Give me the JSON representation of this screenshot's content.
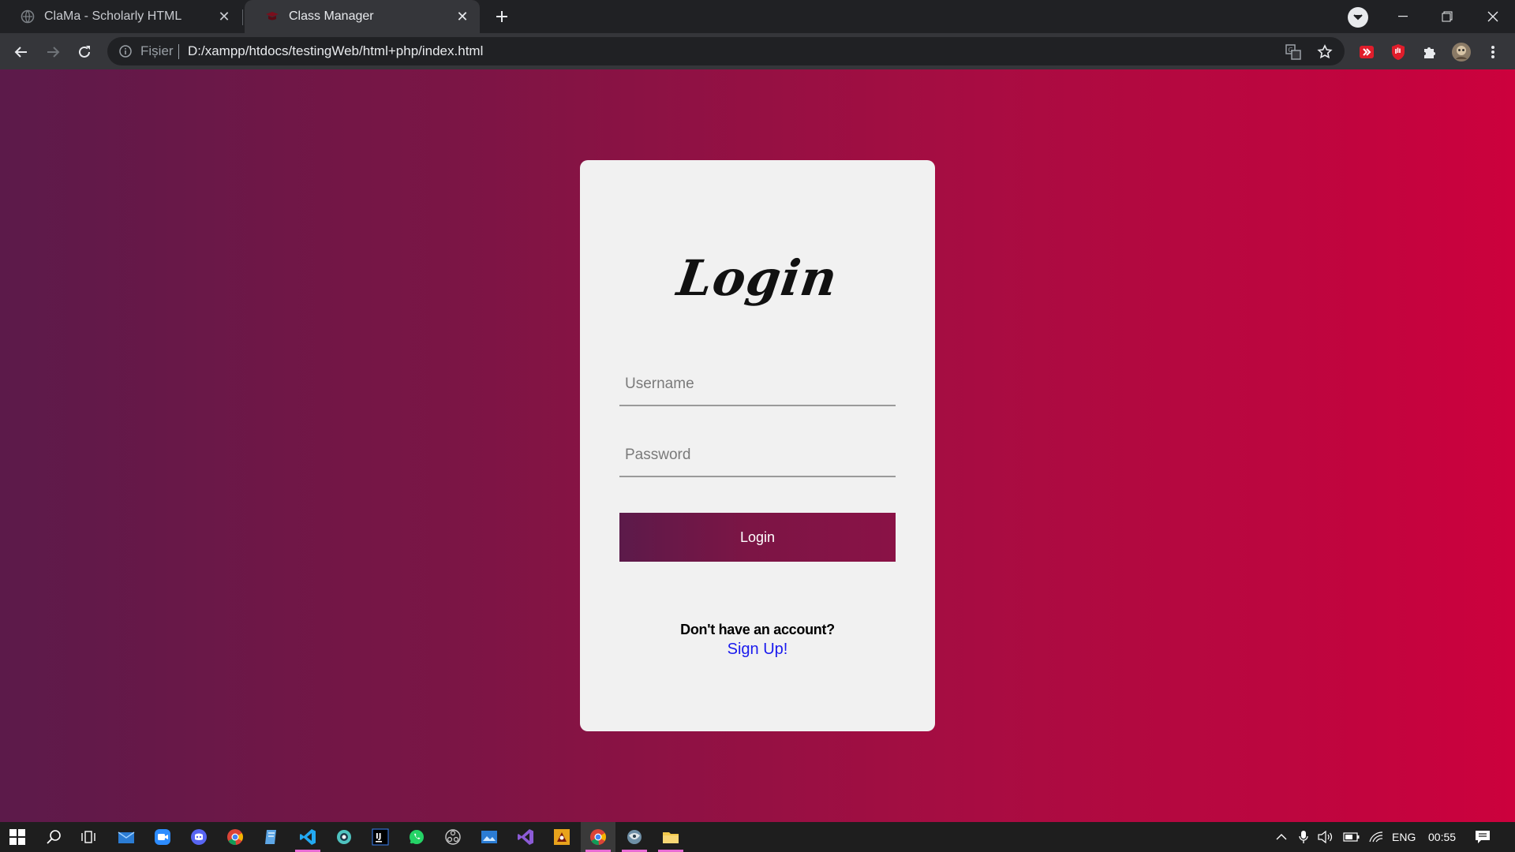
{
  "browser": {
    "tabs": [
      {
        "title": "ClaMa - Scholarly HTML",
        "active": false
      },
      {
        "title": "Class Manager",
        "active": true
      }
    ],
    "address": {
      "scheme_label": "Fișier",
      "url": "D:/xampp/htdocs/testingWeb/html+php/index.html"
    }
  },
  "page": {
    "title": "Login",
    "username_placeholder": "Username",
    "password_placeholder": "Password",
    "login_button": "Login",
    "signup_prompt": "Don't have an account?",
    "signup_link": "Sign Up!"
  },
  "taskbar": {
    "language": "ENG",
    "time": "00:55"
  },
  "colors": {
    "gradient_start": "#5c1a4a",
    "gradient_end": "#cc013d",
    "link": "#1a1aee"
  }
}
